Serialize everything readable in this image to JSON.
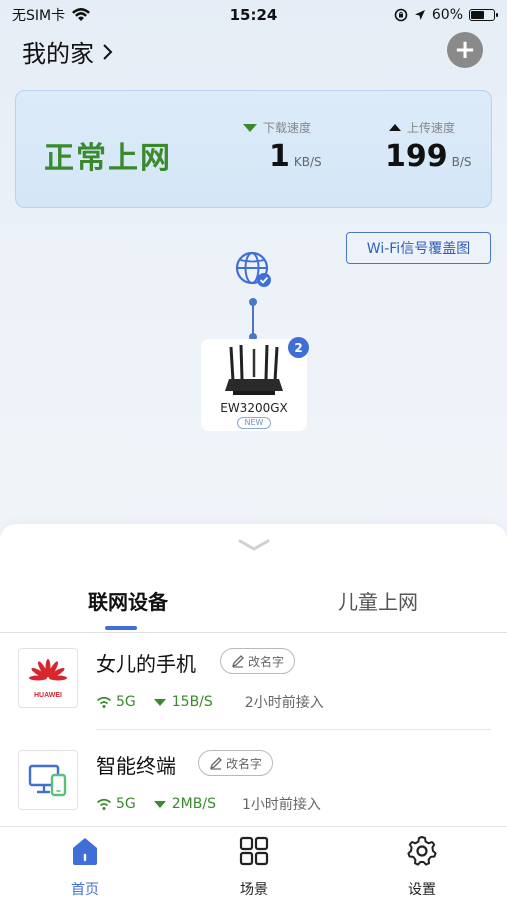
{
  "status_bar": {
    "carrier": "无SIM卡",
    "time": "15:24",
    "battery": "60%",
    "battery_level": 0.6
  },
  "header": {
    "home_title": "我的家",
    "chevron": "›",
    "add_label": "+"
  },
  "network_status": {
    "state": "正常上网",
    "download_label": "下载速度",
    "download_value": "1",
    "download_unit": "KB/S",
    "upload_label": "上传速度",
    "upload_value": "199",
    "upload_unit": "B/S"
  },
  "coverage_button": "Wi-Fi信号覆盖图",
  "topology": {
    "router_name": "EW3200GX",
    "new_tag": "NEW",
    "badge_count": "2"
  },
  "tabs": [
    {
      "label": "联网设备"
    },
    {
      "label": "儿童上网"
    }
  ],
  "devices": [
    {
      "name": "女儿的手机",
      "rename": "改名字",
      "band": "5G",
      "speed": "15B/S",
      "time": "2小时前接入",
      "brand_text": "HUAWEI"
    },
    {
      "name": "智能终端",
      "rename": "改名字",
      "band": "5G",
      "speed": "2MB/S",
      "time": "1小时前接入"
    }
  ],
  "bottom_nav": [
    {
      "label": "首页"
    },
    {
      "label": "场景"
    },
    {
      "label": "设置"
    }
  ],
  "colors": {
    "primary": "#3f6fd6",
    "online_green": "#3a8a2c",
    "card_bg": "#d4e6f7"
  }
}
